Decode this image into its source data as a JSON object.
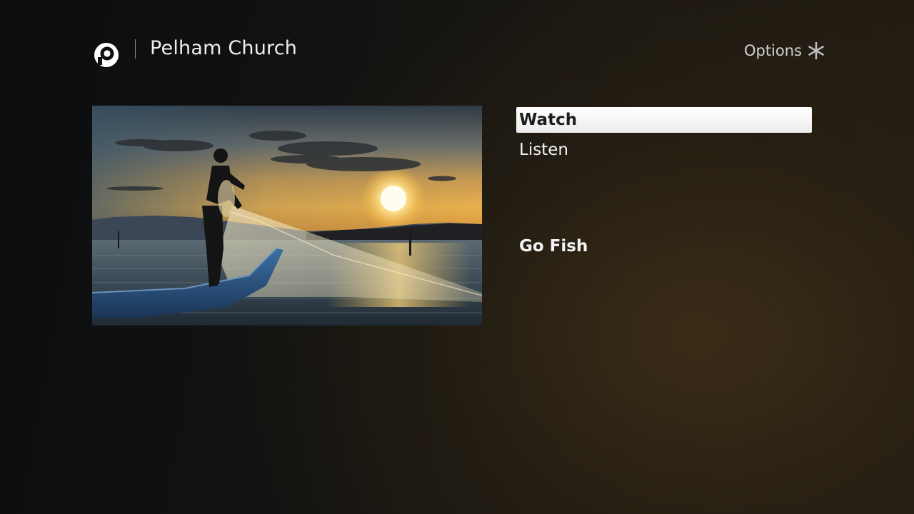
{
  "header": {
    "title": "Pelham Church",
    "logo_icon": "pelham-p-logo",
    "options_label": "Options",
    "options_icon": "asterisk-icon"
  },
  "hero": {
    "image_subject": "fisherman-casting-net-at-sunset"
  },
  "menu": {
    "items": [
      {
        "label": "Watch",
        "selected": true
      },
      {
        "label": "Listen",
        "selected": false
      },
      {
        "label": "Go Fish",
        "selected": false
      }
    ]
  },
  "colors": {
    "selected_bg": "#f2f2f2",
    "selected_text": "#1c1c1c",
    "text": "#f3f3f3",
    "bg_dark": "#0b0d0f",
    "bg_warm": "#241d13"
  }
}
